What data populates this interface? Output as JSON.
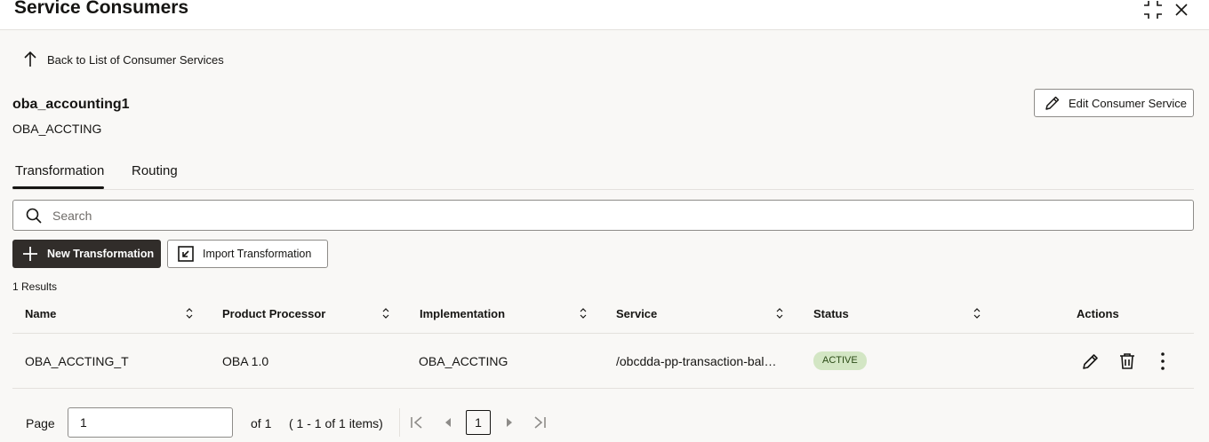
{
  "header": {
    "title": "Service Consumers"
  },
  "back_link": {
    "label": "Back to List of Consumer Services"
  },
  "record": {
    "name": "oba_accounting1",
    "code": "OBA_ACCTING"
  },
  "edit_button": {
    "label": "Edit Consumer Service"
  },
  "tabs": [
    {
      "label": "Transformation",
      "selected": true
    },
    {
      "label": "Routing",
      "selected": false
    }
  ],
  "search": {
    "placeholder": "Search",
    "value": ""
  },
  "toolbar": {
    "new_label": "New Transformation",
    "import_label": "Import Transformation"
  },
  "results": {
    "count_label": "1 Results"
  },
  "table": {
    "columns": [
      "Name",
      "Product Processor",
      "Implementation",
      "Service",
      "Status",
      "Actions"
    ],
    "rows": [
      {
        "name": "OBA_ACCTING_T",
        "processor": "OBA 1.0",
        "implementation": "OBA_ACCTING",
        "service": "/obcdda-pp-transaction-bal…",
        "status": "ACTIVE"
      }
    ]
  },
  "pager": {
    "page_label": "Page",
    "page_value": "1",
    "of_label": "of 1",
    "range_label": "( 1 - 1 of 1 items)",
    "current_page": "1"
  },
  "colors": {
    "primary_dark": "#312d2a",
    "status_active_bg": "#d3e6c4",
    "border": "#8e8c89"
  },
  "icons": [
    "maximize-icon",
    "close-icon",
    "arrow-up-icon",
    "pencil-icon",
    "search-icon",
    "plus-icon",
    "import-icon",
    "sort-icon",
    "trash-icon",
    "more-vertical-icon",
    "first-page-icon",
    "prev-page-icon",
    "next-page-icon",
    "last-page-icon"
  ]
}
